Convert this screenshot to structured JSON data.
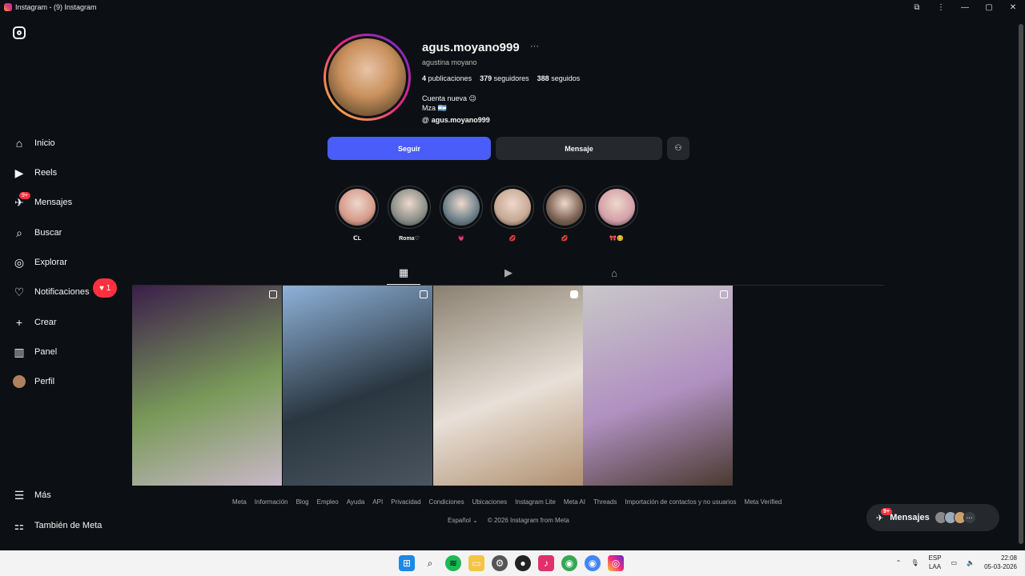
{
  "window": {
    "title": "Instagram - (9) Instagram"
  },
  "sidebar": {
    "items": [
      {
        "label": "Inicio",
        "icon": "home-icon"
      },
      {
        "label": "Reels",
        "icon": "reels-icon"
      },
      {
        "label": "Mensajes",
        "icon": "messenger-icon",
        "badge": "9+"
      },
      {
        "label": "Buscar",
        "icon": "search-icon"
      },
      {
        "label": "Explorar",
        "icon": "explore-icon"
      },
      {
        "label": "Notificaciones",
        "icon": "heart-icon",
        "pill": "1"
      },
      {
        "label": "Crear",
        "icon": "plus-icon"
      },
      {
        "label": "Panel",
        "icon": "dashboard-icon"
      },
      {
        "label": "Perfil",
        "icon": "avatar"
      }
    ],
    "bottom": [
      {
        "label": "Más",
        "icon": "menu-icon"
      },
      {
        "label": "También de Meta",
        "icon": "meta-icon"
      }
    ]
  },
  "profile": {
    "username": "agus.moyano999",
    "full_name": "agustina moyano",
    "posts": "4",
    "posts_label": "publicaciones",
    "followers": "379",
    "followers_label": "seguidores",
    "following": "388",
    "following_label": "seguidos",
    "bio_line1": "Cuenta nueva 😉",
    "bio_line2": "Mza 🇦🇷",
    "threads_handle": "agus.moyano999",
    "follow_label": "Seguir",
    "message_label": "Mensaje"
  },
  "highlights": [
    {
      "label": "ᑕL",
      "color": "#d69a8a"
    },
    {
      "label": "Roma♡",
      "color": "#8a8f88"
    },
    {
      "label": "💗",
      "color": "#6b7f88"
    },
    {
      "label": "💋",
      "color": "#c7a894"
    },
    {
      "label": "💋",
      "color": "#7a6050"
    },
    {
      "label": "🎀🥴",
      "color": "#d4a0a8"
    }
  ],
  "posts": [
    {
      "type": "carousel",
      "colors": [
        "#3b1e4a",
        "#7a9a5a",
        "#c9b8c8"
      ]
    },
    {
      "type": "carousel",
      "colors": [
        "#8fb2d9",
        "#2a3640",
        "#4a5560"
      ]
    },
    {
      "type": "reel",
      "colors": [
        "#8a8070",
        "#e8e0d8",
        "#b09070"
      ]
    },
    {
      "type": "carousel",
      "colors": [
        "#c8c8c8",
        "#b090c0",
        "#4a3a30"
      ]
    }
  ],
  "footer": {
    "links": [
      "Meta",
      "Información",
      "Blog",
      "Empleo",
      "Ayuda",
      "API",
      "Privacidad",
      "Condiciones",
      "Ubicaciones",
      "Instagram Lite",
      "Meta AI",
      "Threads",
      "Importación de contactos y no usuarios",
      "Meta Verified"
    ],
    "language": "Español",
    "copyright": "© 2026 Instagram from Meta"
  },
  "messages_widget": {
    "label": "Mensajes",
    "badge": "9+"
  },
  "taskbar": {
    "lang_top": "ESP",
    "lang_bottom": "LAA",
    "time": "22:08",
    "date": "05-03-2026"
  }
}
